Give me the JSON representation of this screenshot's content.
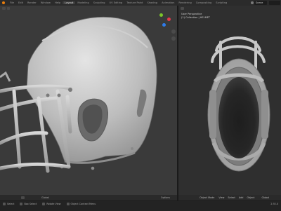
{
  "topbar": {
    "tabs": [
      "File",
      "Edit",
      "Render",
      "Window",
      "Help",
      "Layout",
      "Modeling",
      "Sculpting",
      "UV Editing",
      "Texture Paint",
      "Shading",
      "Animation",
      "Rendering",
      "Compositing",
      "Scripting"
    ],
    "active_tab_index": 5,
    "scene": "Scene"
  },
  "right_viewport": {
    "overlay_line1": "User Perspective",
    "overlay_line2": "(1) Collection | HELMET"
  },
  "left_footer": {
    "transform_label": "Global",
    "options_label": "Options"
  },
  "right_footer": {
    "mode": "Object Mode",
    "view": "View",
    "select": "Select",
    "add": "Add",
    "object": "Object",
    "transform": "Global"
  },
  "statusbar": {
    "select": "Select",
    "box_select": "Box Select",
    "rotate": "Rotate View",
    "context_menu": "Object Context Menu",
    "version": "2.92.0"
  },
  "colors": {
    "accent_orange": "#e87d0d",
    "gizmo_x": "#e6394b",
    "gizmo_y": "#7bc52a",
    "gizmo_z": "#2e7cea"
  },
  "icons": [
    "blender-logo",
    "axis-gizmo",
    "zoom-icon",
    "pan-icon",
    "camera-icon",
    "grid-icon"
  ]
}
